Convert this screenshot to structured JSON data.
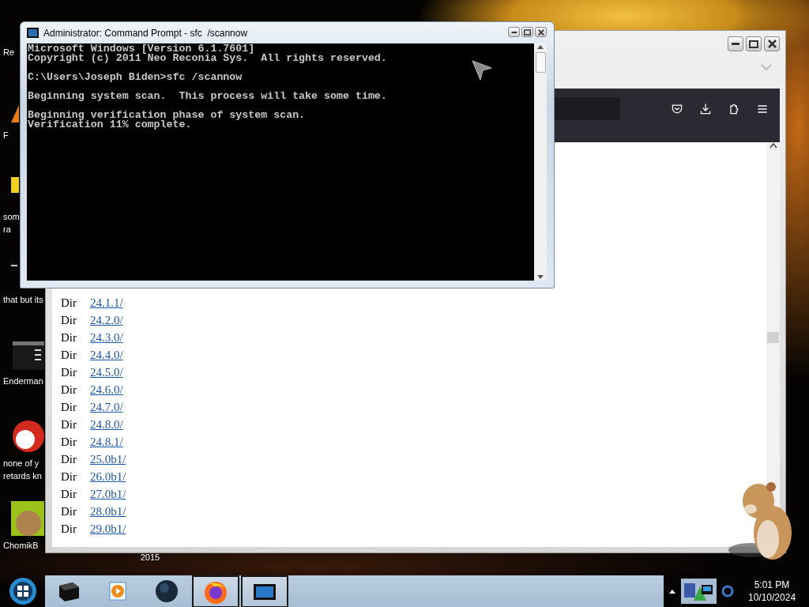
{
  "desktop_icons": [
    {
      "kind": "none",
      "labels": [
        "Re"
      ]
    },
    {
      "kind": "orange",
      "labels": [
        "F"
      ]
    },
    {
      "kind": "yellow",
      "labels": [
        "som",
        "ra"
      ]
    },
    {
      "kind": "dash",
      "labels": [
        "that but its"
      ]
    },
    {
      "kind": "monitor",
      "labels": [
        "Enderman"
      ]
    },
    {
      "kind": "red",
      "labels": [
        "none of y",
        "retards kn"
      ]
    },
    {
      "kind": "hamster",
      "labels": [
        "ChomikB"
      ]
    },
    {
      "kind": "none",
      "labels": [
        "2015"
      ]
    }
  ],
  "browser": {
    "listing": [
      {
        "type": "Dir",
        "name": "24.1.1/"
      },
      {
        "type": "Dir",
        "name": "24.2.0/"
      },
      {
        "type": "Dir",
        "name": "24.3.0/"
      },
      {
        "type": "Dir",
        "name": "24.4.0/"
      },
      {
        "type": "Dir",
        "name": "24.5.0/"
      },
      {
        "type": "Dir",
        "name": "24.6.0/"
      },
      {
        "type": "Dir",
        "name": "24.7.0/"
      },
      {
        "type": "Dir",
        "name": "24.8.0/"
      },
      {
        "type": "Dir",
        "name": "24.8.1/"
      },
      {
        "type": "Dir",
        "name": "25.0b1/"
      },
      {
        "type": "Dir",
        "name": "26.0b1/"
      },
      {
        "type": "Dir",
        "name": "27.0b1/"
      },
      {
        "type": "Dir",
        "name": "28.0b1/"
      },
      {
        "type": "Dir",
        "name": "29.0b1/"
      }
    ]
  },
  "console": {
    "title": "Administrator: Command Prompt - sfc  /scannow",
    "blocks": [
      [
        "Microsoft Windows [Version 6.1.7601]",
        "Copyright (c) 2011 Neo Reconia Sys.  All rights reserved."
      ],
      [
        "C:\\Users\\Joseph Biden>sfc /scannow"
      ],
      [
        "Beginning system scan.  This process will take some time."
      ],
      [
        "Beginning verification phase of system scan.",
        "Verification 11% complete."
      ]
    ]
  },
  "taskbar": {
    "items": [
      {
        "kind": "box",
        "open": false
      },
      {
        "kind": "media",
        "open": false
      },
      {
        "kind": "globe",
        "open": false
      },
      {
        "kind": "browser",
        "open": true
      },
      {
        "kind": "terminal",
        "open": true
      }
    ],
    "time": "5:01 PM",
    "date": "10/10/2024"
  }
}
